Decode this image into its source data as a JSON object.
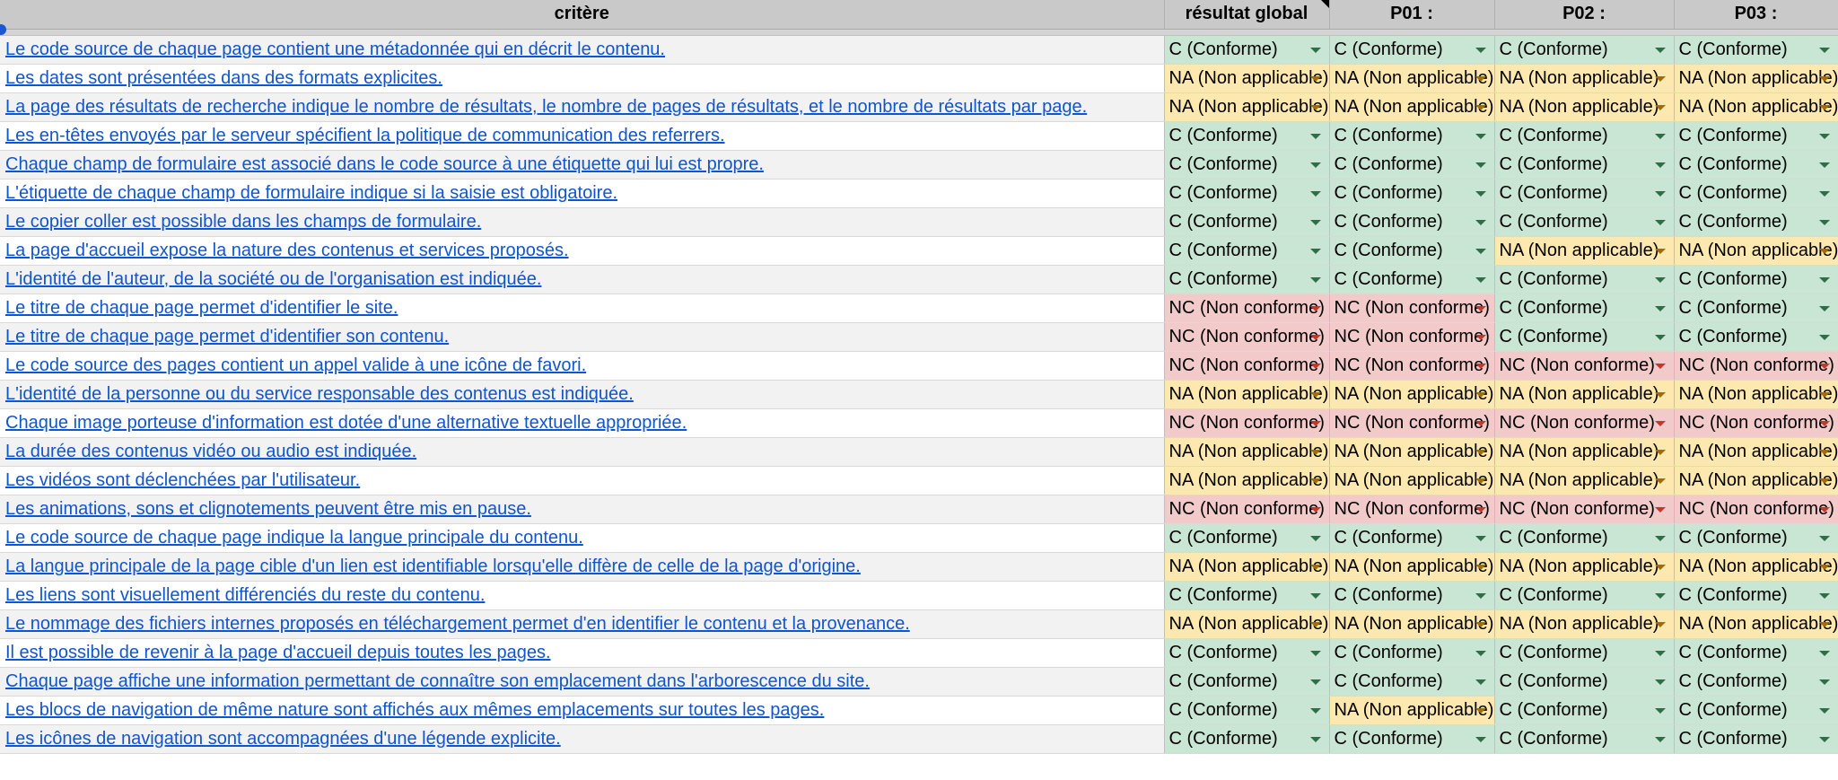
{
  "colors": {
    "C": "#c9e5d3",
    "NA": "#fde8b0",
    "NC": "#f3caca",
    "link": "#1155cc",
    "header_bg": "#c9c9c9"
  },
  "status_labels": {
    "C": "C (Conforme)",
    "NA": "NA (Non applicable)",
    "NC": "NC (Non conforme)"
  },
  "headers": {
    "criteria": "critère",
    "global": "résultat global",
    "p01": "P01 :",
    "p02": "P02 :",
    "p03": "P03 :"
  },
  "rows": [
    {
      "criterion": "Le code source de chaque page contient une métadonnée qui en décrit le contenu.",
      "global": "C",
      "p01": "C",
      "p02": "C",
      "p03": "C"
    },
    {
      "criterion": "Les dates sont présentées dans des formats explicites.",
      "global": "NA",
      "p01": "NA",
      "p02": "NA",
      "p03": "NA"
    },
    {
      "criterion": "La page des résultats de recherche indique le nombre de résultats, le nombre de pages de résultats, et le nombre de résultats par page.",
      "global": "NA",
      "p01": "NA",
      "p02": "NA",
      "p03": "NA"
    },
    {
      "criterion": "Les en-têtes envoyés par le serveur spécifient la politique de communication des referrers.",
      "global": "C",
      "p01": "C",
      "p02": "C",
      "p03": "C"
    },
    {
      "criterion": "Chaque champ de formulaire est associé dans le code source à une étiquette qui lui est propre.",
      "global": "C",
      "p01": "C",
      "p02": "C",
      "p03": "C"
    },
    {
      "criterion": "L'étiquette de chaque champ de formulaire indique si la saisie est obligatoire.",
      "global": "C",
      "p01": "C",
      "p02": "C",
      "p03": "C"
    },
    {
      "criterion": "Le copier coller est possible dans les champs de formulaire.",
      "global": "C",
      "p01": "C",
      "p02": "C",
      "p03": "C"
    },
    {
      "criterion": "La page d'accueil expose la nature des contenus et services proposés.",
      "global": "C",
      "p01": "C",
      "p02": "NA",
      "p03": "NA"
    },
    {
      "criterion": "L'identité de l'auteur, de la société ou de l'organisation est indiquée.",
      "global": "C",
      "p01": "C",
      "p02": "C",
      "p03": "C"
    },
    {
      "criterion": "Le titre de chaque page permet d'identifier le site.",
      "global": "NC",
      "p01": "NC",
      "p02": "C",
      "p03": "C"
    },
    {
      "criterion": "Le titre de chaque page permet d'identifier son contenu.",
      "global": "NC",
      "p01": "NC",
      "p02": "C",
      "p03": "C"
    },
    {
      "criterion": "Le code source des pages contient un appel valide à une icône de favori.",
      "global": "NC",
      "p01": "NC",
      "p02": "NC",
      "p03": "NC"
    },
    {
      "criterion": "L'identité de la personne ou du service responsable des contenus est indiquée.",
      "global": "NA",
      "p01": "NA",
      "p02": "NA",
      "p03": "NA"
    },
    {
      "criterion": "Chaque image porteuse d'information est dotée d'une alternative textuelle appropriée.",
      "global": "NC",
      "p01": "NC",
      "p02": "NC",
      "p03": "NC"
    },
    {
      "criterion": "La durée des contenus vidéo ou audio est indiquée.",
      "global": "NA",
      "p01": "NA",
      "p02": "NA",
      "p03": "NA"
    },
    {
      "criterion": "Les vidéos sont déclenchées par l'utilisateur.",
      "global": "NA",
      "p01": "NA",
      "p02": "NA",
      "p03": "NA"
    },
    {
      "criterion": "Les animations, sons et clignotements peuvent être mis en pause.",
      "global": "NC",
      "p01": "NC",
      "p02": "NC",
      "p03": "NC"
    },
    {
      "criterion": "Le code source de chaque page indique la langue principale du contenu.",
      "global": "C",
      "p01": "C",
      "p02": "C",
      "p03": "C"
    },
    {
      "criterion": "La langue principale de la page cible d'un lien est identifiable lorsqu'elle diffère de celle de la page d'origine.",
      "global": "NA",
      "p01": "NA",
      "p02": "NA",
      "p03": "NA"
    },
    {
      "criterion": "Les liens sont visuellement différenciés du reste du contenu.",
      "global": "C",
      "p01": "C",
      "p02": "C",
      "p03": "C"
    },
    {
      "criterion": "Le nommage des fichiers internes proposés en téléchargement permet d'en identifier le contenu et la provenance.",
      "global": "NA",
      "p01": "NA",
      "p02": "NA",
      "p03": "NA"
    },
    {
      "criterion": "Il est possible de revenir à la page d'accueil depuis toutes les pages.",
      "global": "C",
      "p01": "C",
      "p02": "C",
      "p03": "C"
    },
    {
      "criterion": "Chaque page affiche une information permettant de connaître son emplacement dans l'arborescence du site.",
      "global": "C",
      "p01": "C",
      "p02": "C",
      "p03": "C"
    },
    {
      "criterion": "Les blocs de navigation de même nature sont affichés aux mêmes emplacements sur toutes les pages.",
      "global": "C",
      "p01": "NA",
      "p02": "C",
      "p03": "C"
    },
    {
      "criterion": "Les icônes de navigation sont accompagnées d'une légende explicite.",
      "global": "C",
      "p01": "C",
      "p02": "C",
      "p03": "C"
    }
  ]
}
